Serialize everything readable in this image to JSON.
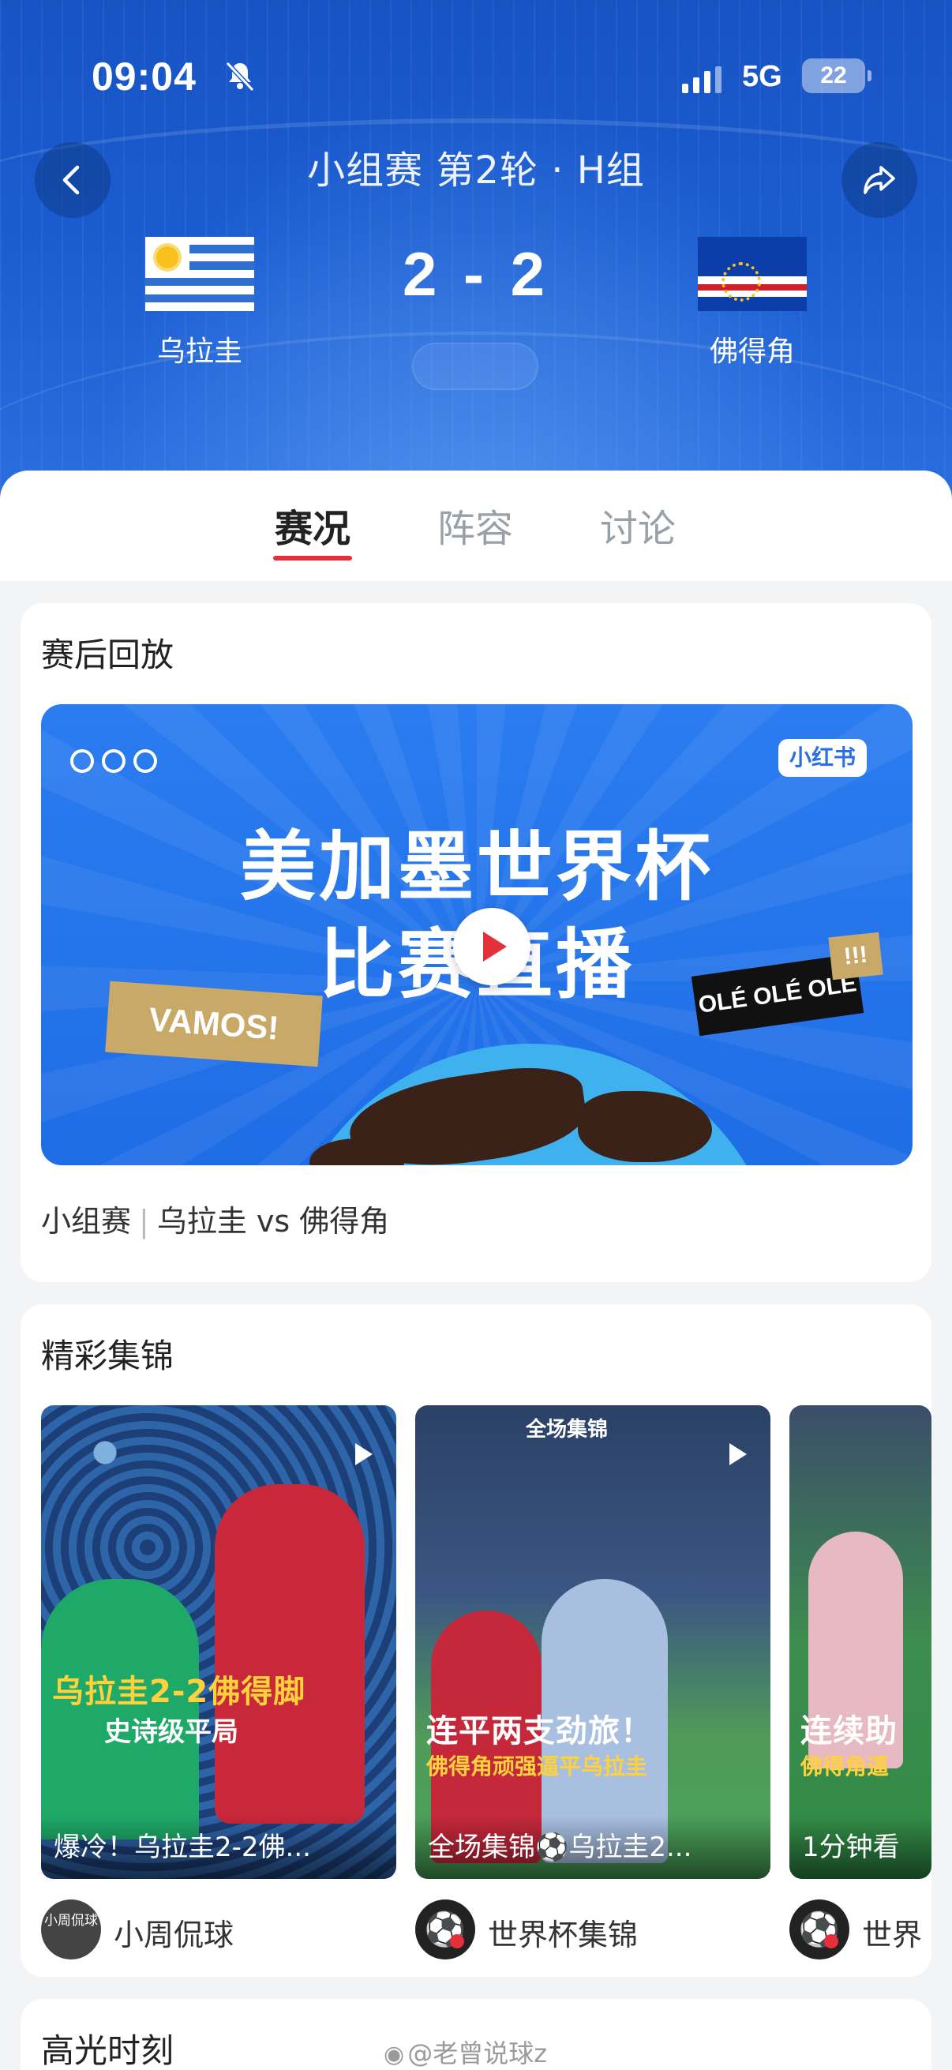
{
  "status_bar": {
    "time": "09:04",
    "network": "5G",
    "battery": "22",
    "icons": [
      "bell-off-icon",
      "signal-icon",
      "battery-icon"
    ]
  },
  "header": {
    "title": "小组赛 第2轮 · H组",
    "back_icon": "chevron-left-icon",
    "share_icon": "share-icon",
    "home_team": {
      "name": "乌拉圭",
      "flag": "uruguay-flag"
    },
    "away_team": {
      "name": "佛得角",
      "flag": "cape-verde-flag"
    },
    "score": "2 - 2",
    "colors": {
      "background": "#1a5cd0",
      "accent": "#e5303b"
    }
  },
  "tabs": [
    {
      "label": "赛况",
      "active": true
    },
    {
      "label": "阵容",
      "active": false
    },
    {
      "label": "讨论",
      "active": false
    }
  ],
  "replay": {
    "section_title": "赛后回放",
    "banner": {
      "line1": "美加墨世界杯",
      "line2": "比赛直播",
      "brand": "小红书",
      "tag_left": "VAMOS!",
      "tag_right": "OLÉ OLÉ OLÉ",
      "tag_bang": "!!!"
    },
    "caption_stage": "小组赛",
    "caption_match": "乌拉圭 vs 佛得角"
  },
  "highlights": {
    "section_title": "精彩集锦",
    "videos": [
      {
        "overlay_title": "乌拉圭2-2佛得脚",
        "overlay_sub": "史诗级平局",
        "caption": "爆冷！乌拉圭2-2佛...",
        "author": "小周侃球",
        "avatar_text": "小周侃球"
      },
      {
        "tag": "全场集锦",
        "overlay_title": "连平两支劲旅！",
        "overlay_sub": "佛得角顽强逼平乌拉圭",
        "caption": "全场集锦⚽乌拉圭2...",
        "author": "世界杯集锦"
      },
      {
        "overlay_title": "连续助",
        "overlay_sub": "佛得角逼",
        "caption": "1分钟看",
        "author": "世界"
      }
    ]
  },
  "moments": {
    "section_title": "高光时刻"
  },
  "watermark": "@老曾说球z"
}
